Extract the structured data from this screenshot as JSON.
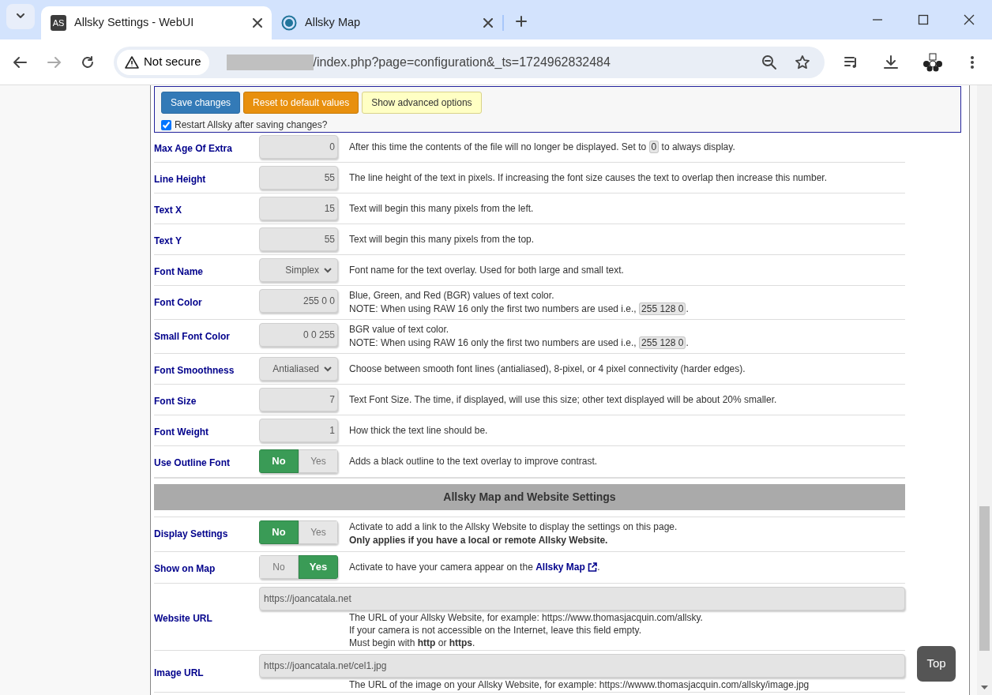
{
  "browser": {
    "tabs": [
      {
        "favicon": "AS",
        "title": "Allsky Settings - WebUI",
        "selected": true
      },
      {
        "title": "Allsky Map",
        "selected": false
      }
    ],
    "address": {
      "security": "Not secure",
      "url": "/index.php?page=configuration&_ts=1724962832484"
    }
  },
  "action_bar": {
    "buttons": [
      {
        "label": "Save changes",
        "kind": "primary"
      },
      {
        "label": "Reset to default values",
        "kind": "warning"
      },
      {
        "label": "Show advanced options",
        "kind": "light"
      }
    ],
    "restart": {
      "label": "Restart Allsky after saving changes?",
      "checked": true
    }
  },
  "settings": [
    {
      "kind": "setting",
      "label": "Max Age Of Extra",
      "control": {
        "kind": "number",
        "value": "0"
      },
      "description": [
        [
          {
            "kind": "text",
            "text": "After this time the contents of the file will no longer be displayed. Set to "
          },
          {
            "kind": "code",
            "text": "0"
          },
          {
            "kind": "text",
            "text": " to always display."
          }
        ]
      ]
    },
    {
      "kind": "setting",
      "label": "Line Height",
      "control": {
        "kind": "number",
        "value": "55"
      },
      "description": [
        [
          {
            "kind": "text",
            "text": "The line height of the text in pixels. If increasing the font size causes the text to overlap then increase this number."
          }
        ]
      ]
    },
    {
      "kind": "setting",
      "label": "Text X",
      "control": {
        "kind": "number",
        "value": "15"
      },
      "description": [
        [
          {
            "kind": "text",
            "text": "Text will begin this many pixels from the left."
          }
        ]
      ]
    },
    {
      "kind": "setting",
      "label": "Text Y",
      "control": {
        "kind": "number",
        "value": "55"
      },
      "description": [
        [
          {
            "kind": "text",
            "text": "Text will begin this many pixels from the top."
          }
        ]
      ]
    },
    {
      "kind": "setting",
      "label": "Font Name",
      "control": {
        "kind": "select",
        "value": "Simplex"
      },
      "description": [
        [
          {
            "kind": "text",
            "text": "Font name for the text overlay. Used for both large and small text."
          }
        ]
      ]
    },
    {
      "kind": "setting",
      "label": "Font Color",
      "control": {
        "kind": "number",
        "value": "255 0 0"
      },
      "description": [
        [
          {
            "kind": "text",
            "text": "Blue, Green, and Red (BGR) values of text color."
          }
        ],
        [
          {
            "kind": "text",
            "text": "NOTE: When using RAW 16 only the first two numbers are used i.e., "
          },
          {
            "kind": "code",
            "text": "255 128 0"
          },
          {
            "kind": "text",
            "text": "."
          }
        ]
      ]
    },
    {
      "kind": "setting",
      "label": "Small Font Color",
      "control": {
        "kind": "number",
        "value": "0 0 255"
      },
      "description": [
        [
          {
            "kind": "text",
            "text": "BGR value of text color."
          }
        ],
        [
          {
            "kind": "text",
            "text": "NOTE: When using RAW 16 only the first two numbers are used i.e., "
          },
          {
            "kind": "code",
            "text": "255 128 0"
          },
          {
            "kind": "text",
            "text": "."
          }
        ]
      ]
    },
    {
      "kind": "setting",
      "label": "Font Smoothness",
      "control": {
        "kind": "select",
        "value": "Antialiased"
      },
      "description": [
        [
          {
            "kind": "text",
            "text": "Choose between smooth font lines (antialiased), 8-pixel, or 4 pixel connectivity (harder edges)."
          }
        ]
      ]
    },
    {
      "kind": "setting",
      "label": "Font Size",
      "control": {
        "kind": "number",
        "value": "7"
      },
      "description": [
        [
          {
            "kind": "text",
            "text": "Text Font Size. The time, if displayed, will use this size; other text displayed will be about 20% smaller."
          }
        ]
      ]
    },
    {
      "kind": "setting",
      "label": "Font Weight",
      "control": {
        "kind": "number",
        "value": "1"
      },
      "description": [
        [
          {
            "kind": "text",
            "text": "How thick the text line should be."
          }
        ]
      ]
    },
    {
      "kind": "setting",
      "label": "Use Outline Font",
      "control": {
        "kind": "toggle",
        "options": [
          {
            "label": "No",
            "selected": true
          },
          {
            "label": "Yes",
            "selected": false
          }
        ]
      },
      "description": [
        [
          {
            "kind": "text",
            "text": "Adds a black outline to the text overlay to improve contrast."
          }
        ]
      ]
    },
    {
      "kind": "section",
      "label": "Allsky Map and Website Settings"
    },
    {
      "kind": "setting",
      "label": "Display Settings",
      "control": {
        "kind": "toggle",
        "options": [
          {
            "label": "No",
            "selected": true
          },
          {
            "label": "Yes",
            "selected": false
          }
        ]
      },
      "description": [
        [
          {
            "kind": "text",
            "text": "Activate to add a link to the Allsky Website to display the settings on this page."
          }
        ],
        [
          {
            "kind": "text",
            "text": "**Only applies if you have a local or remote Allsky Website.**"
          }
        ]
      ]
    },
    {
      "kind": "setting",
      "label": "Show on Map",
      "control": {
        "kind": "toggle",
        "options": [
          {
            "label": "No",
            "selected": false
          },
          {
            "label": "Yes",
            "selected": true
          }
        ]
      },
      "description": [
        [
          {
            "kind": "text",
            "text": "Activate to have your camera appear on the "
          },
          {
            "kind": "link",
            "text": "Allsky Map"
          },
          {
            "kind": "text",
            "text": "."
          }
        ]
      ]
    },
    {
      "kind": "setting",
      "label": "Website URL",
      "control": {
        "kind": "url",
        "value": "https://joancatala.net"
      },
      "description": [
        [
          {
            "kind": "text",
            "text": "The URL of your Allsky Website, for example: https://www.thomasjacquin.com/allsky."
          }
        ],
        [
          {
            "kind": "text",
            "text": "If your camera is not accessible on the Internet, leave this field empty."
          }
        ],
        [
          {
            "kind": "text",
            "text": "Must begin with **http** or **https**."
          }
        ]
      ]
    },
    {
      "kind": "setting",
      "label": "Image URL",
      "control": {
        "kind": "url",
        "value": "https://joancatala.net/cel1.jpg"
      },
      "description": [
        [
          {
            "kind": "text",
            "text": "The URL of the image on your Allsky Website, for example: https://wwww.thomasjacquin.com/allsky/image.jpg"
          }
        ]
      ]
    }
  ],
  "top_button": "Top"
}
